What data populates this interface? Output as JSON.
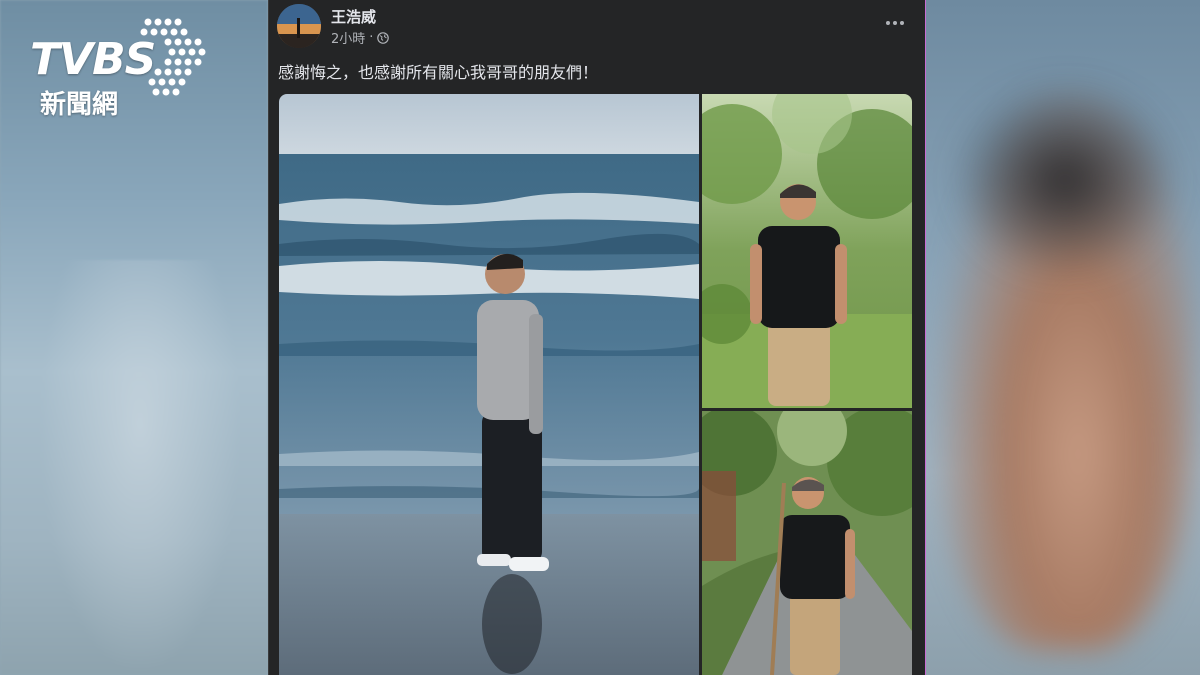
{
  "watermark": {
    "logo_text": "TVBS",
    "logo_subtitle": "新聞網"
  },
  "post": {
    "author": "王浩威",
    "time": "2小時",
    "separator": "·",
    "privacy_icon": "globe-icon",
    "more_icon": "more-options-icon",
    "caption": "感謝悔之，也感謝所有關心我哥哥的朋友們！",
    "photos": [
      {
        "name": "photo-beach",
        "subject": "man in grey t-shirt standing at the seashore"
      },
      {
        "name": "photo-forest",
        "subject": "man in black t-shirt standing on grass among trees"
      },
      {
        "name": "photo-path",
        "subject": "man with walking stick on a forest path"
      }
    ]
  },
  "colors": {
    "panel_bg": "#242526",
    "text_primary": "#e4e6eb",
    "text_secondary": "#b0b3b8"
  }
}
